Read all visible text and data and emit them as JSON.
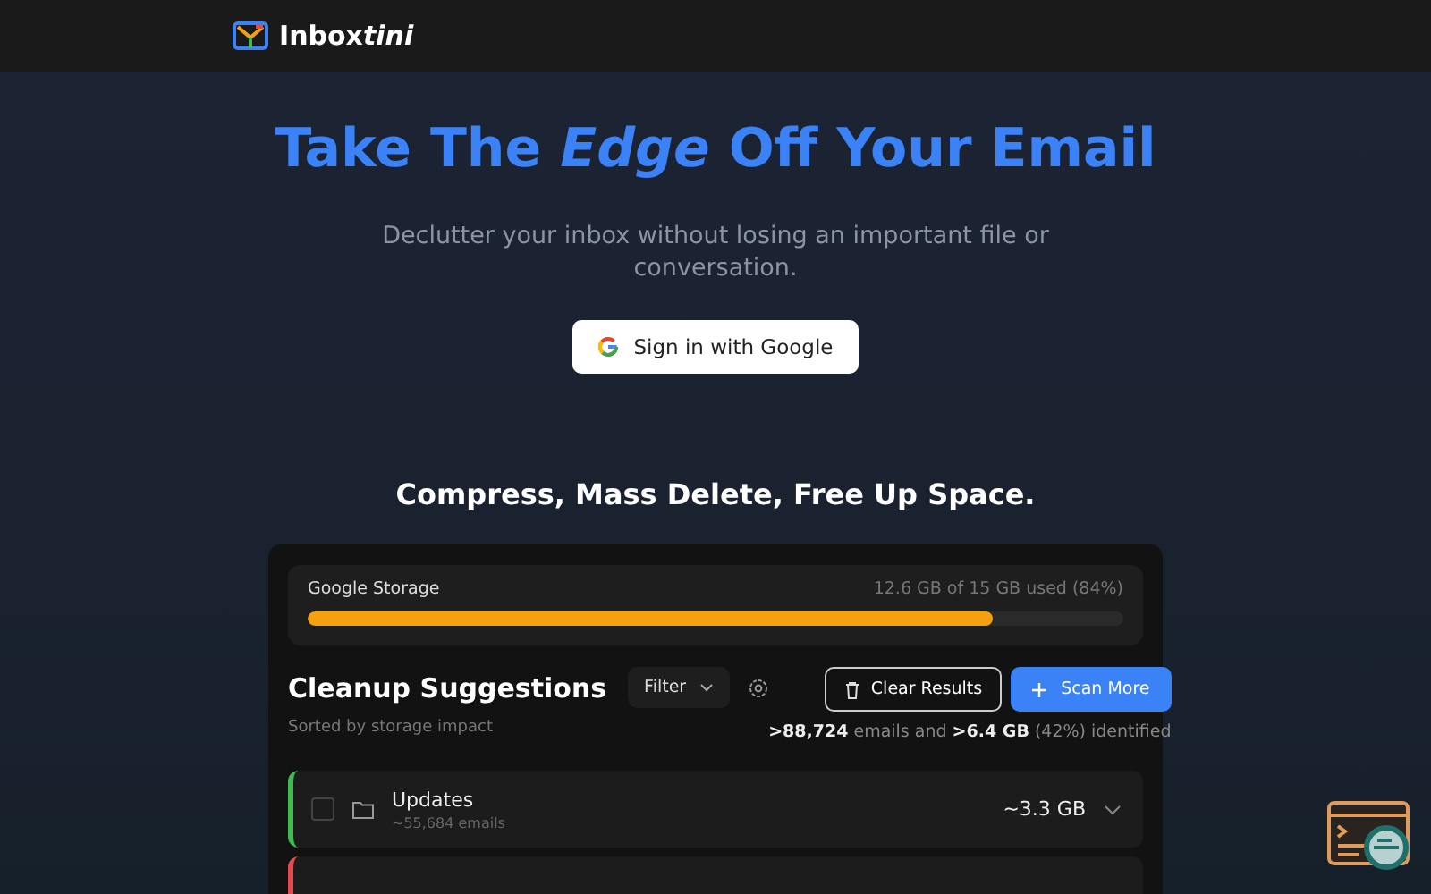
{
  "header": {
    "logo": "Inbox",
    "logo_accent": "tini"
  },
  "hero": {
    "title": "Take The *Edge* Off Your Email",
    "subtitle": "Declutter your inbox without losing an important file or conversation.",
    "signin": "Sign in with Google"
  },
  "tagline": "Compress, Mass Delete, Free Up Space.",
  "storage": {
    "label": "Google Storage",
    "reading": "12.6 GB of 15 GB used (84%)",
    "level": 0.84
  },
  "cleanup": {
    "title": "Cleanup Suggestions",
    "subtitle": "Sorted by storage impact",
    "filter": "Filter",
    "clear": "Clear Results",
    "scan": "Scan More",
    "summary": "**>88,724** emails and **>6.4 GB** (42%) identified"
  },
  "suggestions": [
    {
      "name": "Updates",
      "count": "~55,684 emails",
      "size": "~3.3 GB",
      "color": "#3fb950",
      "checked": false
    },
    {
      "color": "#e5484d"
    }
  ]
}
